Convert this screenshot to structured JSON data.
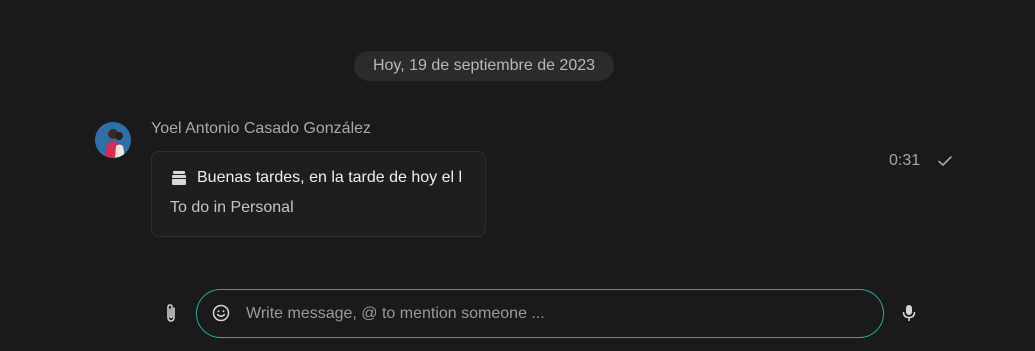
{
  "chat": {
    "date_separator": "Hoy, 19 de septiembre de 2023",
    "message": {
      "sender": "Yoel Antonio Casado González",
      "time": "0:31",
      "status_icon": "check-icon",
      "card": {
        "icon": "task-stack-icon",
        "title": "Buenas tardes, en la tarde de hoy el l",
        "subtitle": "To do in Personal"
      }
    }
  },
  "composer": {
    "placeholder": "Write message, @ to mention someone ...",
    "value": "",
    "accent_color": "#2aa7a4"
  },
  "icons": {
    "attach": "paperclip-icon",
    "emoji": "smiley-icon",
    "mic": "microphone-icon"
  }
}
